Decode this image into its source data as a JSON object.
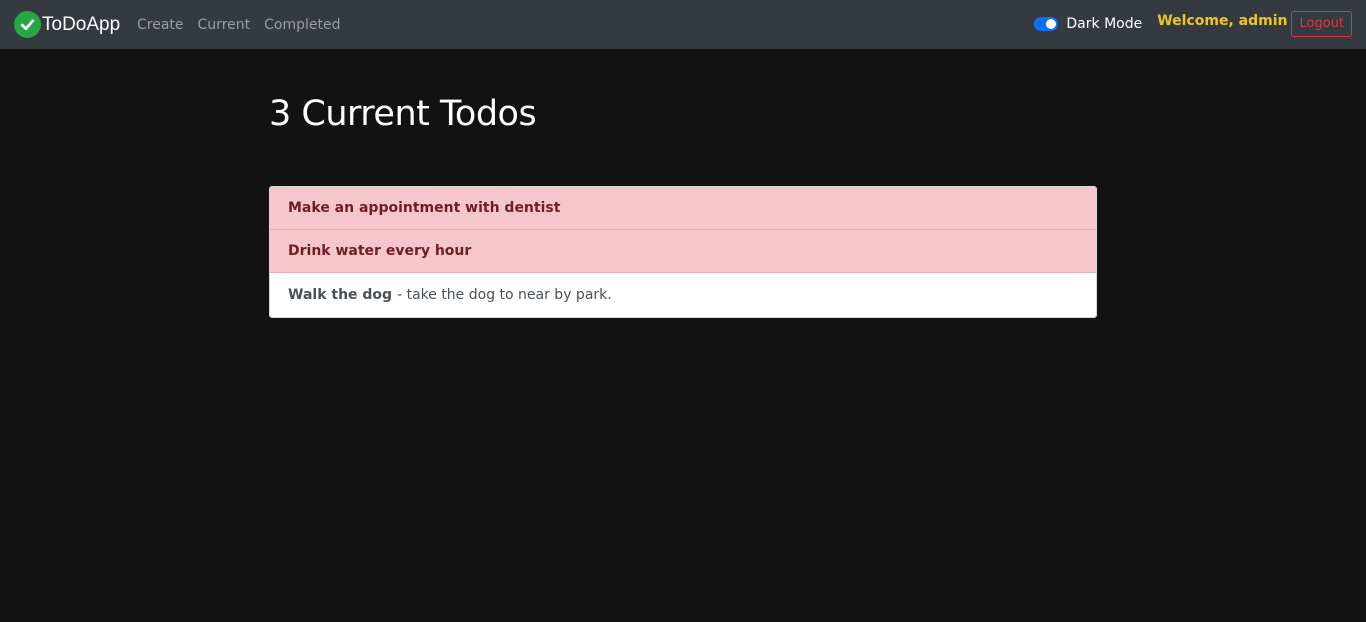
{
  "navbar": {
    "brand": "ToDoApp",
    "brand_icon": "check-circle-icon",
    "links": [
      "Create",
      "Current",
      "Completed"
    ],
    "dark_mode_label": "Dark Mode",
    "dark_mode_on": true,
    "welcome": "Welcome, admin",
    "logout_label": "Logout"
  },
  "main": {
    "title": "3 Current Todos",
    "todos": [
      {
        "title": "Make an appointment with dentist",
        "description": "",
        "important": true
      },
      {
        "title": "Drink water every hour",
        "description": "",
        "important": true
      },
      {
        "title": "Walk the dog",
        "description": "- take the dog to near by park.",
        "important": false
      }
    ]
  },
  "colors": {
    "navbar_bg": "#343a40",
    "page_bg": "#121212",
    "important_bg": "#f5c6cb",
    "important_text": "#721c24",
    "welcome_text": "#f0c420",
    "logout": "#dc3545",
    "toggle": "#0d6efd",
    "brand_icon": "#28a745"
  }
}
